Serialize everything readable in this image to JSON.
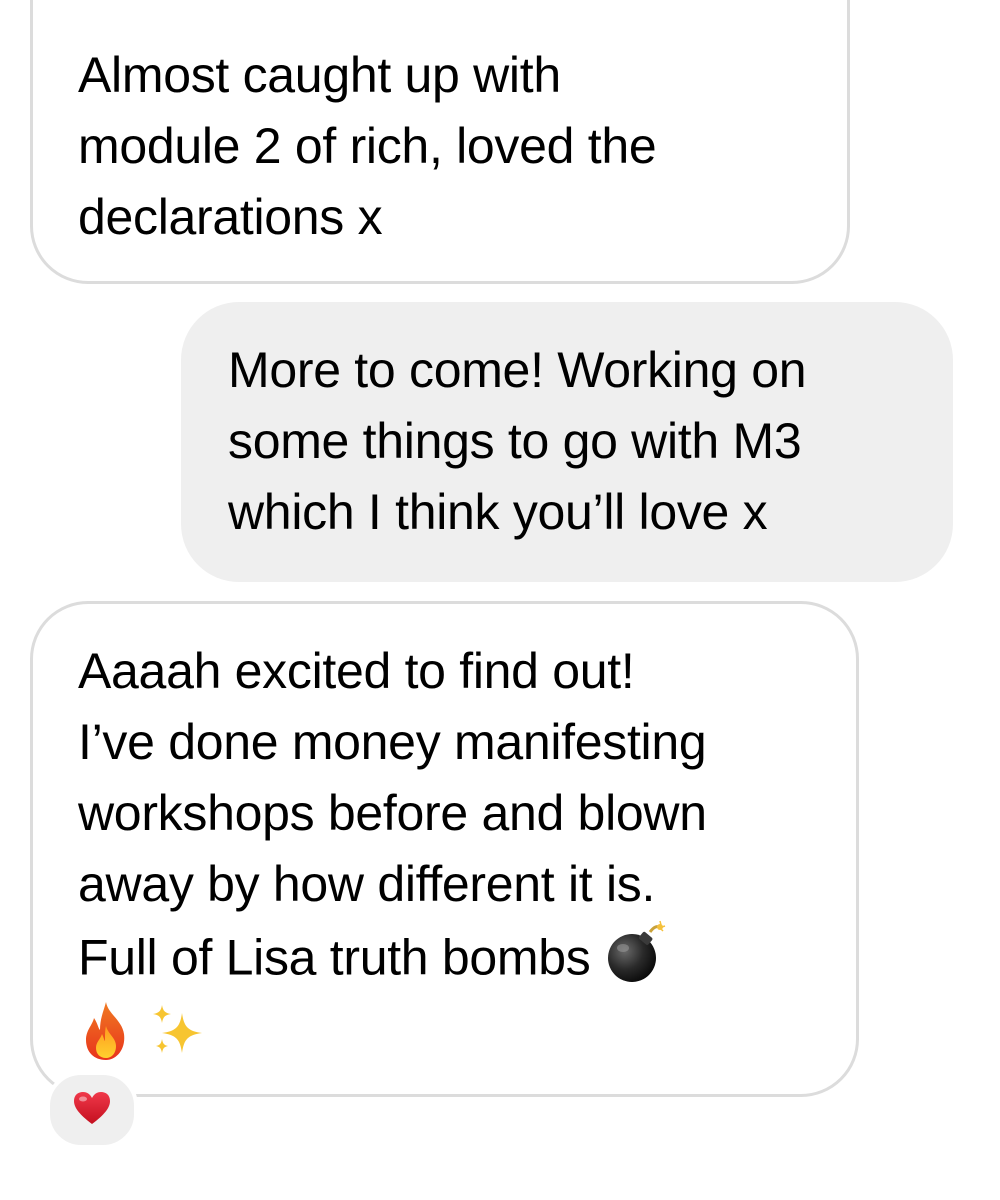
{
  "conversation": {
    "messages": [
      {
        "direction": "incoming",
        "lines": [
          "Almost caught up with",
          "module 2 of rich, loved the",
          "declarations x"
        ]
      },
      {
        "direction": "outgoing",
        "lines": [
          "More to come! Working on",
          "some things to go with M3",
          "which I think you’ll love x"
        ]
      },
      {
        "direction": "incoming",
        "lines": [
          "Aaaah excited to find out!",
          "I’ve done money manifesting",
          "workshops before and blown",
          "away by how different it is.",
          "Full of Lisa truth bombs"
        ],
        "emojis": [
          "bomb-emoji",
          "fire-emoji",
          "sparkles-emoji"
        ],
        "reaction": "red-heart-emoji"
      }
    ]
  },
  "colors": {
    "incoming_bubble_border": "#dcdcdc",
    "outgoing_bubble_background": "#efefef",
    "reaction_background": "#efefef",
    "heart": "#e0202e"
  }
}
